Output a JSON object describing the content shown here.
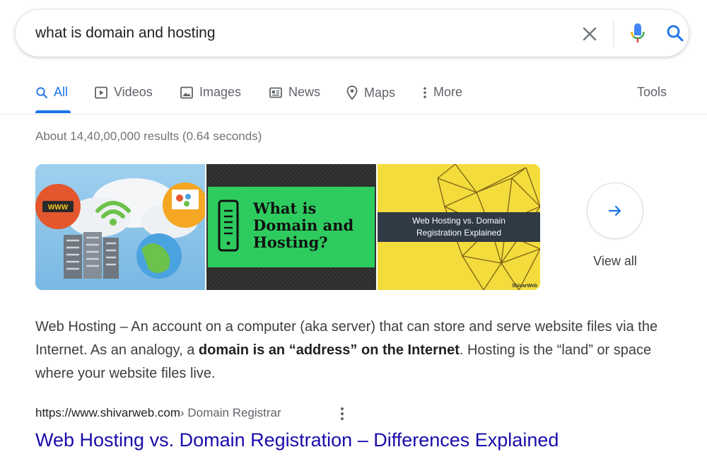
{
  "search": {
    "query": "what is domain and hosting"
  },
  "tabs": [
    {
      "label": "All",
      "icon": "search-icon",
      "active": true
    },
    {
      "label": "Videos",
      "icon": "video-icon"
    },
    {
      "label": "Images",
      "icon": "image-icon"
    },
    {
      "label": "News",
      "icon": "news-icon"
    },
    {
      "label": "Maps",
      "icon": "map-pin-icon"
    },
    {
      "label": "More",
      "icon": "more-vert-icon"
    },
    {
      "label": "Tools"
    }
  ],
  "result_stats": "About 14,40,00,000 results (0.64 seconds)",
  "images": {
    "thumb1_badge": "WWW",
    "thumb2_text": [
      "What is",
      "Domain and",
      "Hosting?"
    ],
    "thumb3_text": [
      "Web Hosting vs. Domain",
      "Registration Explained"
    ],
    "thumb3_watermark": "ShivarWeb",
    "view_all_label": "View all"
  },
  "snippet": {
    "part1": "Web Hosting – An account on a computer (aka server) that can store and serve website files via the Internet. As an analogy, a ",
    "bold": "domain is an “address” on the Internet",
    "part2": ". Hosting is the “land” or space where your website files live."
  },
  "result": {
    "url": "https://www.shivarweb.com",
    "breadcrumb": " › Domain Registrar",
    "title": "Web Hosting vs. Domain Registration – Differences Explained"
  },
  "colors": {
    "accent": "#1a73e8",
    "link": "#1a0dab",
    "thumb2_green": "#2ecc5f",
    "thumb3_yellow": "#f3dc3c"
  }
}
